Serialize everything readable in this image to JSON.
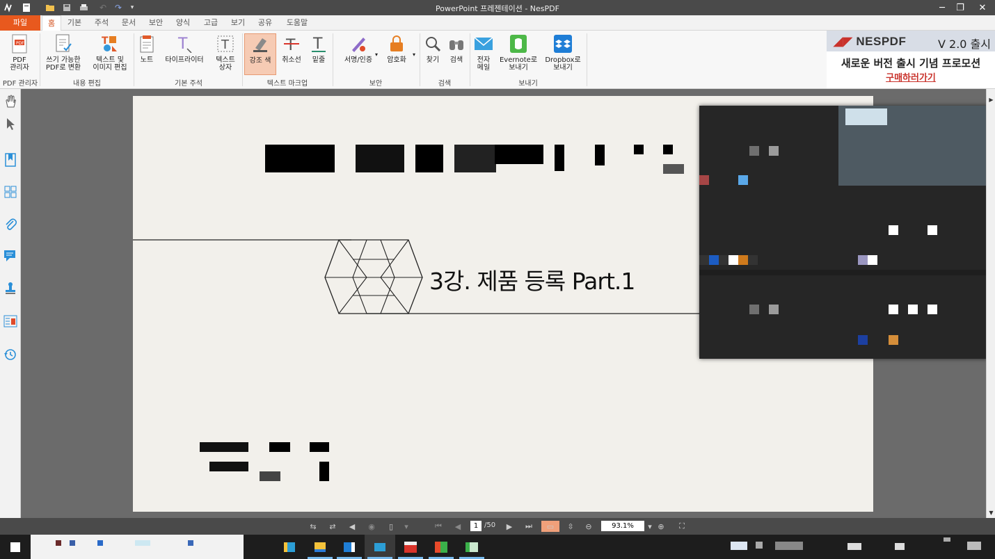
{
  "window": {
    "title": "PowerPoint 프레젠테이션 - NesPDF"
  },
  "tabs": [
    "파일",
    "홈",
    "기본",
    "주석",
    "문서",
    "보안",
    "양식",
    "고급",
    "보기",
    "공유",
    "도움말"
  ],
  "ribbon": {
    "groups": {
      "pdf_manager": "PDF 관리자",
      "content_edit": "내용 편집",
      "basic_annotation": "기본 주석",
      "text_markup": "텍스트 마크업",
      "security": "보안",
      "search": "검색",
      "send": "보내기"
    },
    "buttons": {
      "pdf_manager": "PDF\n관리자",
      "convert_writable": "쓰기 가능한\nPDF로 변환",
      "edit_text_image": "텍스트 및\n이미지 편집",
      "note": "노트",
      "typewriter": "타이프라이터",
      "textbox": "텍스트\n상자",
      "highlight": "강조 색",
      "strikeout": "취소선",
      "underline": "밑줄",
      "sign_cert": "서명/인증",
      "encrypt": "암호화",
      "find": "찾기",
      "search": "검색",
      "email": "전자\n메일",
      "evernote": "Evernote로\n보내기",
      "dropbox": "Dropbox로\n보내기"
    }
  },
  "ad": {
    "brand": "NESPDF",
    "version": "V 2.0 출시",
    "promo": "새로운 버전 출시 기념 프로모션",
    "buy": "구매하러가기"
  },
  "document": {
    "heading": "3강. 제품 등록 Part.1"
  },
  "statusbar": {
    "current_page": "1",
    "total_pages": "/50",
    "zoom": "93.1%"
  },
  "colors": {
    "file_tab": "#e8591e",
    "accent": "#d24c18",
    "ad_red": "#c9322b",
    "highlight_selected": "#f6cbb4"
  }
}
